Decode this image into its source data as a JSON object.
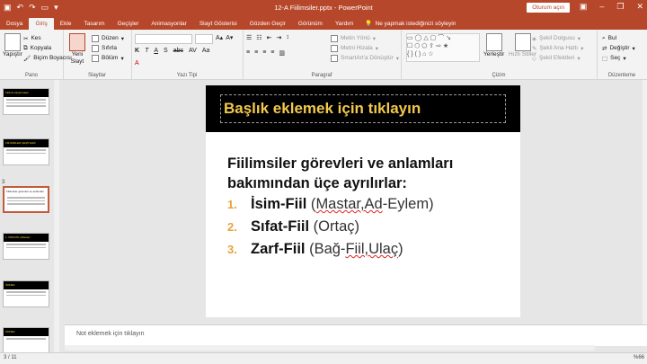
{
  "window": {
    "title": "12-A Fiilimsiler.pptx  -  PowerPoint",
    "signin": "Oturum açın",
    "minimize": "–",
    "restore": "❐",
    "close": "✕"
  },
  "tabs": [
    "Dosya",
    "Giriş",
    "Ekle",
    "Tasarım",
    "Geçişler",
    "Animasyonlar",
    "Slayt Gösterisi",
    "Gözden Geçir",
    "Görünüm",
    "Yardım"
  ],
  "tell_me": "Ne yapmak istediğinizi söyleyin",
  "ribbon": {
    "clipboard": {
      "paste": "Yapıştır",
      "cut": "Kes",
      "copy": "Kopyala",
      "painter": "Biçim Boyacısı",
      "label": "Pano"
    },
    "slides": {
      "new": "Yeni Slayt",
      "layout": "Düzen",
      "reset": "Sıfırla",
      "section": "Bölüm",
      "label": "Slaytlar"
    },
    "font": {
      "label": "Yazı Tipi"
    },
    "paragraph": {
      "text_direction": "Metin Yönü",
      "align_text": "Metni Hizala",
      "smartart": "SmartArt'a Dönüştür",
      "label": "Paragraf"
    },
    "drawing": {
      "arrange": "Yerleştir",
      "quick_styles": "Hızlı Stiller",
      "fill": "Şekil Dolgusu",
      "outline": "Şekil Ana Hattı",
      "effects": "Şekil Efektleri",
      "label": "Çizim"
    },
    "editing": {
      "find": "Bul",
      "replace": "Değiştir",
      "select": "Seç",
      "label": "Düzenleme"
    }
  },
  "thumbnails": [
    {
      "num": "",
      "title": "Fiilimsi Alıştırmaları"
    },
    {
      "num": "",
      "title": "FİİLİMSİLER ÇEŞİTLERİ"
    },
    {
      "num": "3",
      "title": "Fiilimsiler görevleri ve anlamları"
    },
    {
      "num": "",
      "title": "1. İSİM-FİİL (Mastar)"
    },
    {
      "num": "",
      "title": "ÖRNEK"
    },
    {
      "num": "",
      "title": "ÖRNEK"
    }
  ],
  "slide": {
    "title_placeholder": "Başlık eklemek için tıklayın",
    "lead": "Fiilimsiler görevleri ve anlamları bakımından üçe ayrılırlar:",
    "items": [
      {
        "n": "1.",
        "key": "İsim-Fiil",
        "pre": " (",
        "sq": "Mastar,Ad",
        "post": "-Eylem)"
      },
      {
        "n": "2.",
        "key": "Sıfat-Fiil",
        "pre": " (Ortaç)",
        "sq": "",
        "post": ""
      },
      {
        "n": "3.",
        "key": "Zarf-Fiil",
        "pre": " (Bağ-",
        "sq": "Fiil,Ulaç",
        "post": ")"
      }
    ]
  },
  "notes": "Not eklemek için tıklayın",
  "status": {
    "slide": "3 / 11",
    "zoom": "%66"
  }
}
